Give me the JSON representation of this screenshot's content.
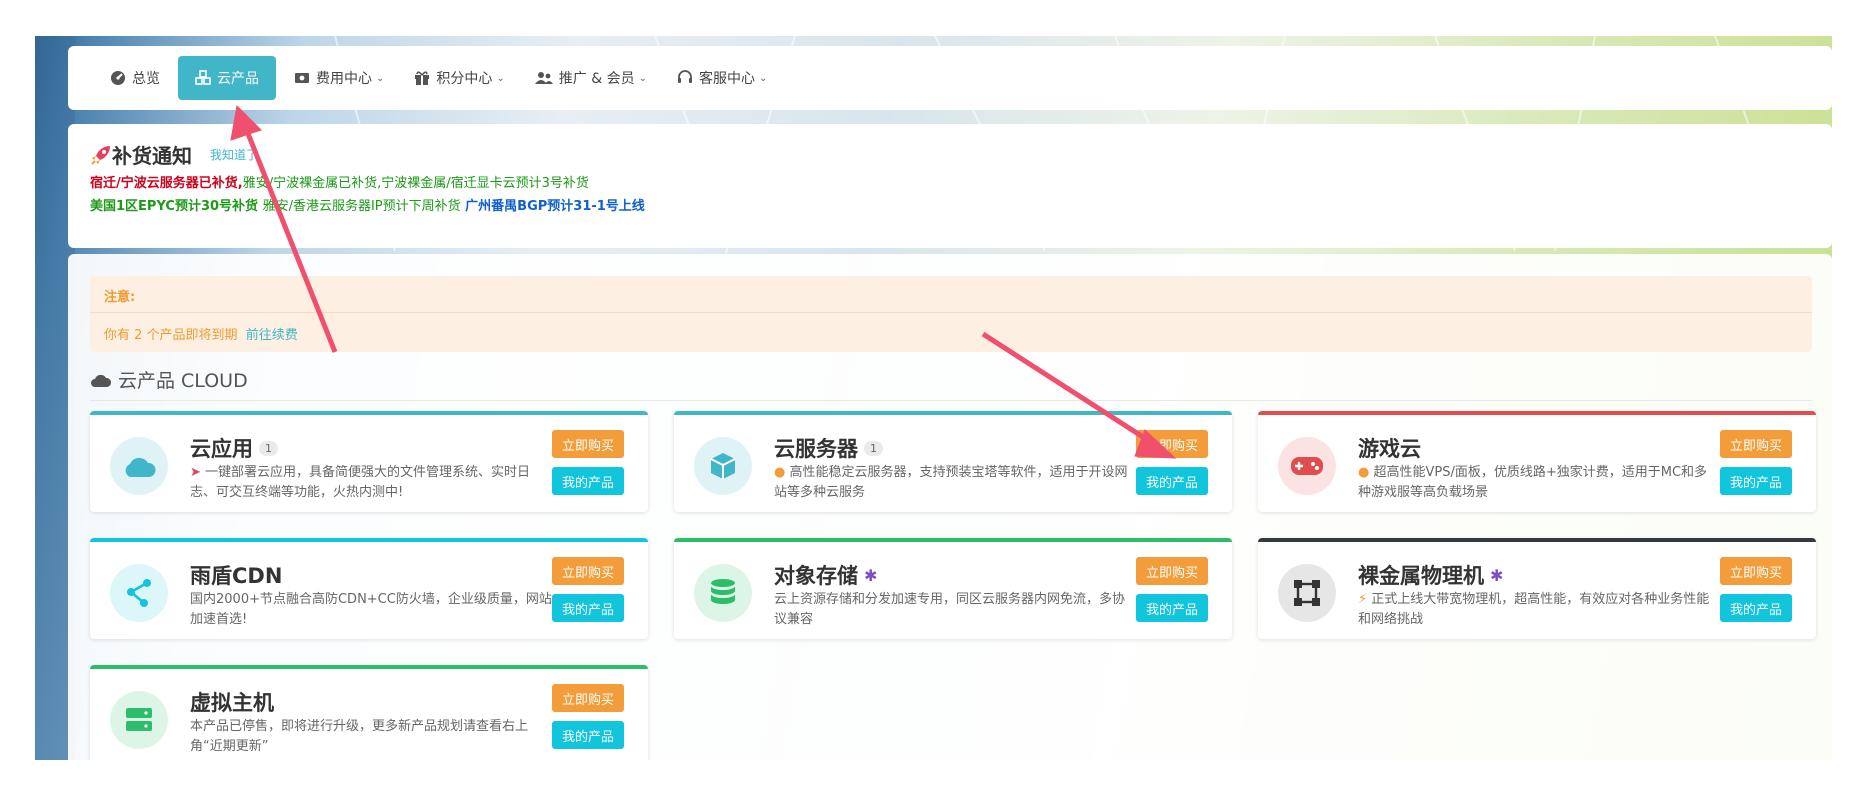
{
  "nav": {
    "items": [
      {
        "label": "总览",
        "icon": "dashboard-icon"
      },
      {
        "label": "云产品",
        "icon": "cubes-icon",
        "active": true
      },
      {
        "label": "费用中心",
        "icon": "money-icon",
        "dropdown": true
      },
      {
        "label": "积分中心",
        "icon": "gift-icon",
        "dropdown": true
      },
      {
        "label": "推广 & 会员",
        "icon": "users-icon",
        "dropdown": true
      },
      {
        "label": "客服中心",
        "icon": "headset-icon",
        "dropdown": true
      }
    ]
  },
  "notice": {
    "title": "补货通知",
    "ack_link": "我知道了",
    "line1_red": "宿迁/宁波云服务器已补货,",
    "line1_grn": "雅安/宁波裸金属已补货,宁波裸金属/宿迁显卡云预计3号补货",
    "line2_grn": "美国1区EPYC预计30号补货",
    "line2_grn2": "雅安/香港云服务器IP预计下周补货",
    "line2_blu": "广州番禺BGP预计31-1号上线"
  },
  "alert": {
    "title": "注意:",
    "message": "你有 2 个产品即将到期",
    "renew_link": "前往续费"
  },
  "section": {
    "title": "云产品 CLOUD"
  },
  "buttons": {
    "buy": "立即购买",
    "mine": "我的产品"
  },
  "cards": [
    {
      "title": "云应用",
      "badge": "1",
      "icon": "cloud-icon",
      "desc": "一键部署云应用，具备简便强大的文件管理系统、实时日志、可交互终端等功能，火热内测中!",
      "accent": "#41b6c8"
    },
    {
      "title": "云服务器",
      "badge": "1",
      "icon": "box-icon",
      "desc": "高性能稳定云服务器，支持预装宝塔等软件，适用于开设网站等多种云服务",
      "accent": "#41b6c8"
    },
    {
      "title": "游戏云",
      "icon": "gamepad-icon",
      "desc": "超高性能VPS/面板，优质线路+独家计费，适用于MC和多种游戏服等高负载场景",
      "accent": "#e14c4c"
    },
    {
      "title": "雨盾CDN",
      "icon": "share-nodes-icon",
      "desc": "国内2000+节点融合高防CDN+CC防火墙，企业级质量，网站加速首选!",
      "accent": "#11c5dd"
    },
    {
      "title": "对象存储",
      "icon": "database-icon",
      "desc": "云上资源存储和分发加速专用，同区云服务器内网免流，多协议兼容",
      "accent": "#2dbe6c"
    },
    {
      "title": "裸金属物理机",
      "icon": "vector-square-icon",
      "desc": "正式上线大带宽物理机，超高性能，有效应对各种业务性能和网络挑战",
      "accent": "#343a40"
    },
    {
      "title": "虚拟主机",
      "icon": "server-icon",
      "desc": "本产品已停售，即将进行升级，更多新产品规划请查看右上角“近期更新”",
      "accent": "#2dbe6c"
    }
  ],
  "colors": {
    "primary": "#41b6c8",
    "warning": "#f39c3a",
    "info": "#11c5dd"
  }
}
